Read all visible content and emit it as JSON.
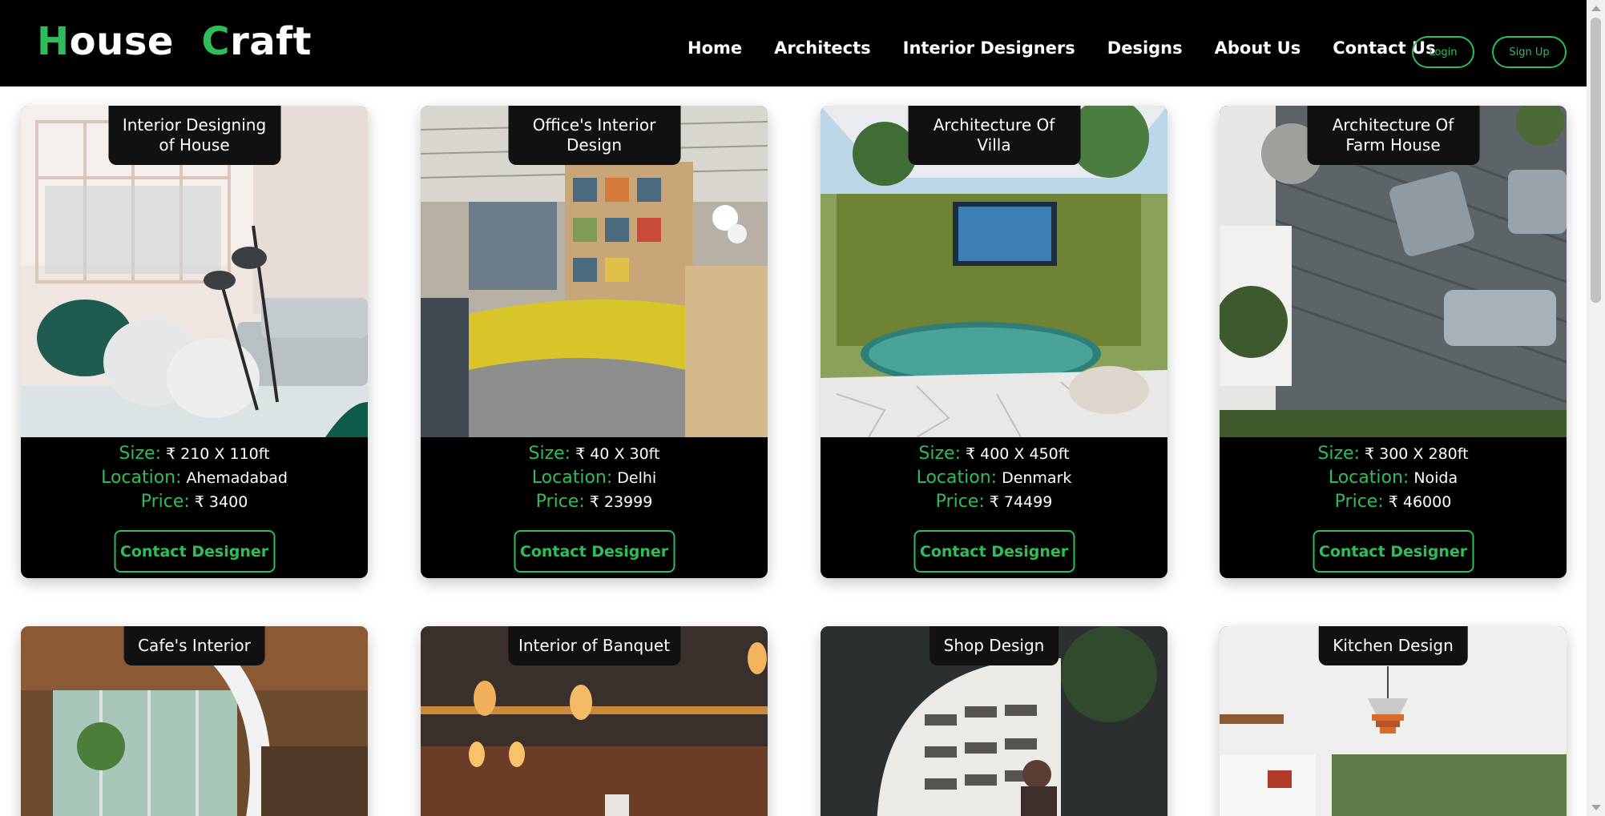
{
  "header": {
    "logo_first_letter": "H",
    "logo_first_rest": "ouse",
    "logo_second_letter": "C",
    "logo_second_rest": "raft",
    "nav": [
      "Home",
      "Architects",
      "Interior Designers",
      "Designs",
      "About Us",
      "Contact Us"
    ],
    "login_label": "Login",
    "signup_label": "Sign Up"
  },
  "labels": {
    "size": "Size:",
    "location": "Location:",
    "price": "Price:",
    "contact": "Contact Designer"
  },
  "cards": [
    {
      "title": "Interior Designing of House",
      "size": "₹ 210 X 110ft",
      "location": "Ahemadabad",
      "price": "₹ 3400",
      "image_icon": "living-room-photo"
    },
    {
      "title": "Office's Interior Design",
      "size": "₹ 40 X 30ft",
      "location": "Delhi",
      "price": "₹ 23999",
      "image_icon": "office-photo"
    },
    {
      "title": "Architecture Of Villa",
      "size": "₹ 400 X 450ft",
      "location": "Denmark",
      "price": "₹ 74499",
      "image_icon": "villa-pool-photo"
    },
    {
      "title": "Architecture Of Farm House",
      "size": "₹ 300 X 280ft",
      "location": "Noida",
      "price": "₹ 46000",
      "image_icon": "farm-deck-photo"
    }
  ],
  "cards_row2": [
    {
      "title": "Cafe's Interior",
      "image_icon": "cafe-photo"
    },
    {
      "title": "Interior of Banquet",
      "image_icon": "banquet-photo"
    },
    {
      "title": "Shop Design",
      "image_icon": "shop-photo"
    },
    {
      "title": "Kitchen Design",
      "image_icon": "kitchen-photo"
    }
  ],
  "colors": {
    "accent": "#2ebd59",
    "navbar": "#000000",
    "card_bg": "#000000"
  }
}
